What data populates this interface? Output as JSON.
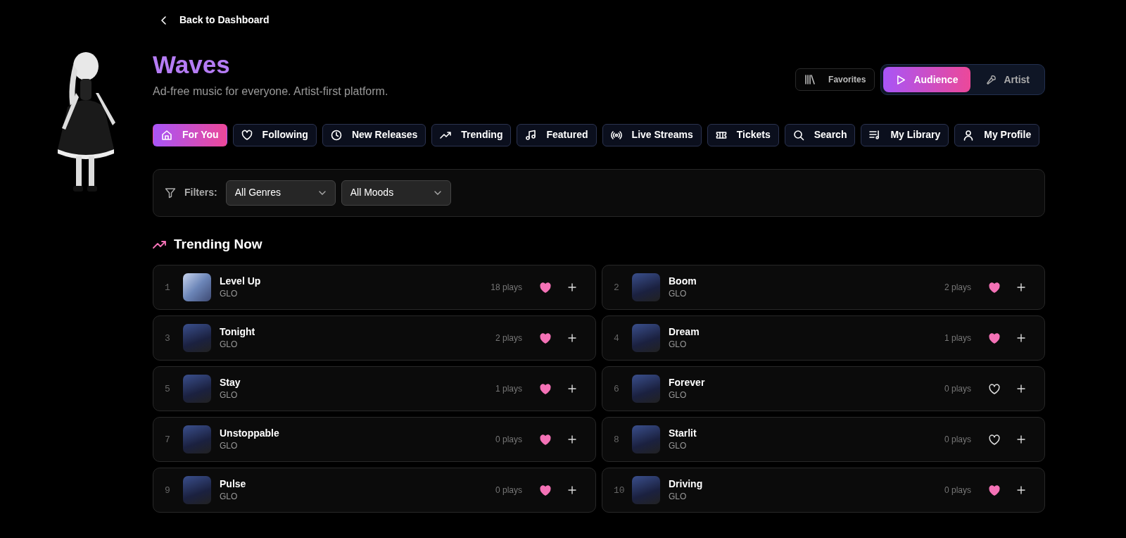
{
  "back_link": "Back to Dashboard",
  "app": {
    "title": "Waves",
    "tagline": "Ad-free music for everyone. Artist-first platform."
  },
  "favorites_button": "Favorites",
  "mode_toggle": [
    {
      "label": "Audience",
      "selected": true
    },
    {
      "label": "Artist",
      "selected": false
    }
  ],
  "nav_tabs": [
    {
      "label": "For You",
      "selected": true
    },
    {
      "label": "Following",
      "selected": false
    },
    {
      "label": "New Releases",
      "selected": false
    },
    {
      "label": "Trending",
      "selected": false
    },
    {
      "label": "Featured",
      "selected": false
    },
    {
      "label": "Live Streams",
      "selected": false
    },
    {
      "label": "Tickets",
      "selected": false
    },
    {
      "label": "Search",
      "selected": false
    },
    {
      "label": "My Library",
      "selected": false
    },
    {
      "label": "My Profile",
      "selected": false
    }
  ],
  "filters": {
    "label": "Filters:",
    "selects": [
      {
        "value": "All Genres"
      },
      {
        "value": "All Moods"
      }
    ]
  },
  "section_title": "Trending Now",
  "tracks": [
    {
      "rank": "1",
      "title": "Level Up",
      "artist": "GLO",
      "plays": "18 plays",
      "liked": true
    },
    {
      "rank": "2",
      "title": "Boom",
      "artist": "GLO",
      "plays": "2 plays",
      "liked": true
    },
    {
      "rank": "3",
      "title": "Tonight",
      "artist": "GLO",
      "plays": "2 plays",
      "liked": true
    },
    {
      "rank": "4",
      "title": "Dream",
      "artist": "GLO",
      "plays": "1 plays",
      "liked": true
    },
    {
      "rank": "5",
      "title": "Stay",
      "artist": "GLO",
      "plays": "1 plays",
      "liked": true
    },
    {
      "rank": "6",
      "title": "Forever",
      "artist": "GLO",
      "plays": "0 plays",
      "liked": false
    },
    {
      "rank": "7",
      "title": "Unstoppable",
      "artist": "GLO",
      "plays": "0 plays",
      "liked": true
    },
    {
      "rank": "8",
      "title": "Starlit",
      "artist": "GLO",
      "plays": "0 plays",
      "liked": false
    },
    {
      "rank": "9",
      "title": "Pulse",
      "artist": "GLO",
      "plays": "0 plays",
      "liked": true
    },
    {
      "rank": "10",
      "title": "Driving",
      "artist": "GLO",
      "plays": "0 plays",
      "liked": true
    }
  ]
}
